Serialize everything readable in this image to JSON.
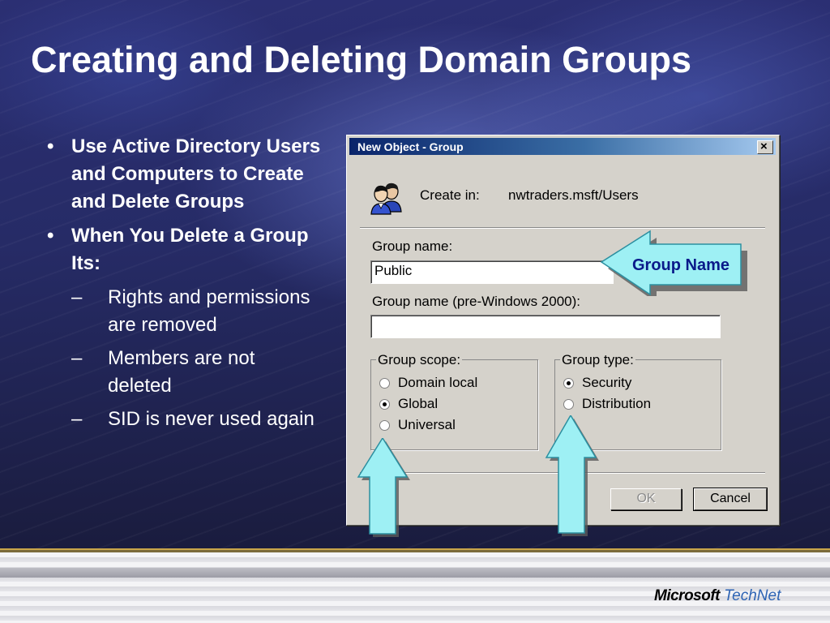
{
  "slide": {
    "title": "Creating and Deleting Domain Groups",
    "bullets": [
      {
        "text": "Use Active Directory Users and Computers to Create and Delete Groups"
      },
      {
        "text": "When You Delete a Group Its:"
      }
    ],
    "subbullets": [
      {
        "text": "Rights and permissions are removed"
      },
      {
        "text": "Members are not deleted"
      },
      {
        "text": "SID is never used again"
      }
    ],
    "bullet_glyph": "•",
    "dash_glyph": "–"
  },
  "dialog": {
    "title": "New Object - Group",
    "close_glyph": "×",
    "create_in_label": "Create in:",
    "create_in_value": "nwtraders.msft/Users",
    "group_name_label": "Group name:",
    "group_name_value": "Public",
    "group_name_pre2000_label": "Group name (pre-Windows 2000):",
    "group_name_pre2000_value": "",
    "scope": {
      "legend": "Group scope:",
      "options": [
        {
          "label": "Domain local",
          "selected": false
        },
        {
          "label": "Global",
          "selected": true
        },
        {
          "label": "Universal",
          "selected": false
        }
      ]
    },
    "type": {
      "legend": "Group type:",
      "options": [
        {
          "label": "Security",
          "selected": true
        },
        {
          "label": "Distribution",
          "selected": false
        }
      ]
    },
    "ok_label": "OK",
    "cancel_label": "Cancel"
  },
  "callout": {
    "label": "Group Name"
  },
  "footer": {
    "brand": "Microsoft",
    "product": "TechNet"
  },
  "colors": {
    "callout_fill": "#9ef0f4",
    "title_text": "#ffffff",
    "dialog_face": "#d5d2cb"
  },
  "icons": {
    "users": "users-icon",
    "close": "close-icon"
  }
}
